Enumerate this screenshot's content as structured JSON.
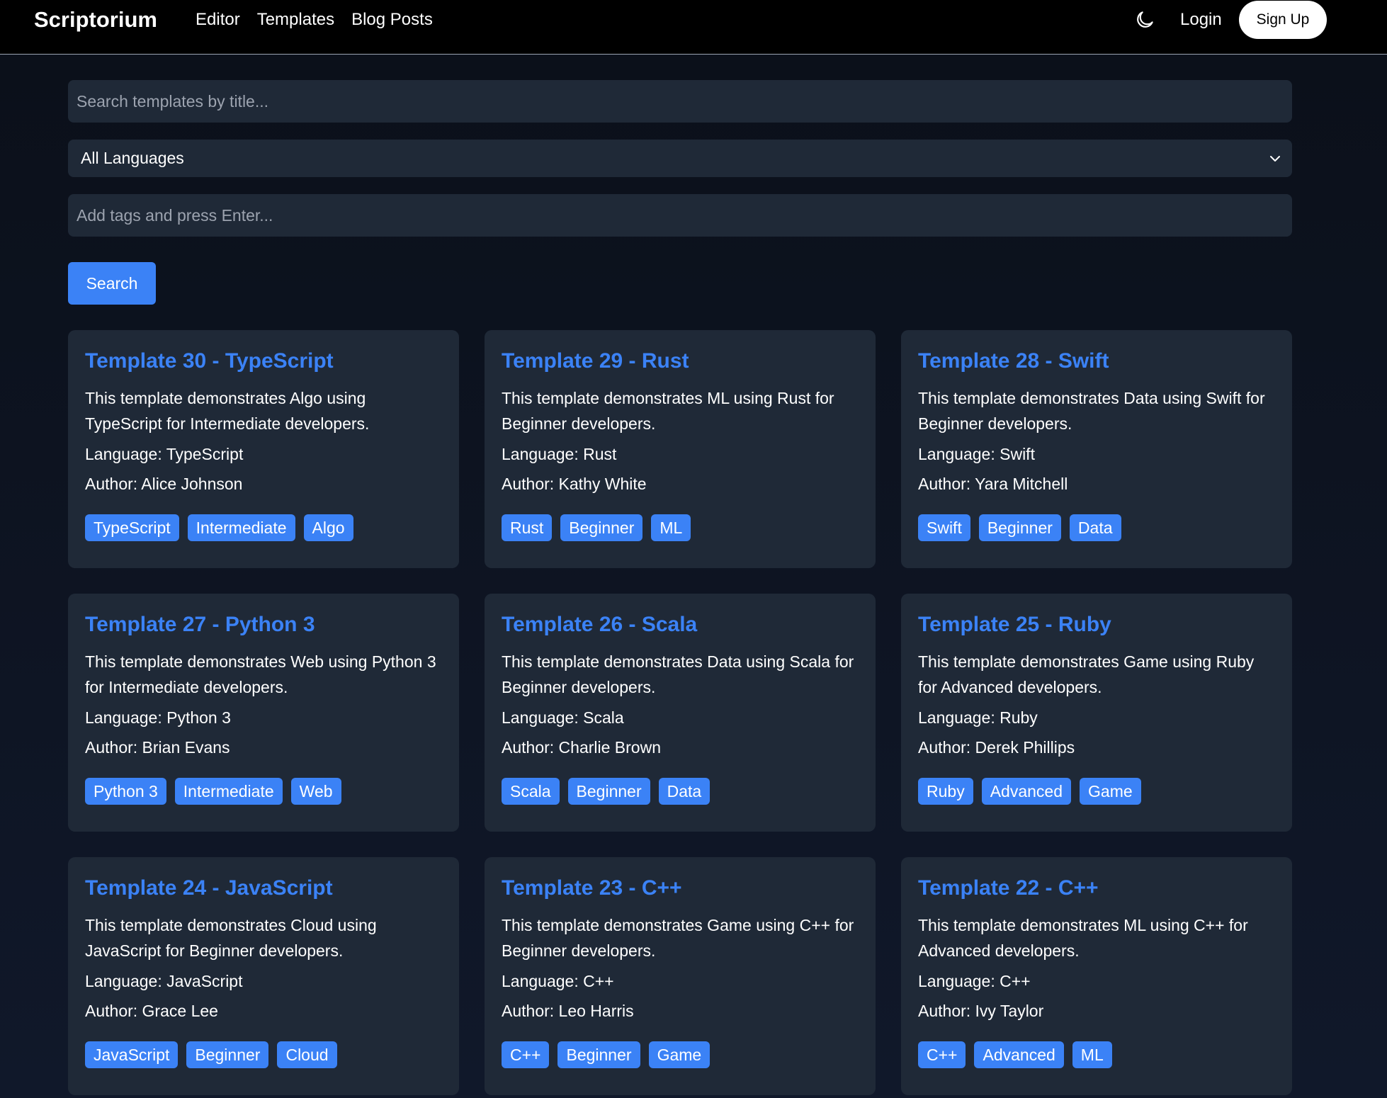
{
  "header": {
    "brand": "Scriptorium",
    "nav": [
      "Editor",
      "Templates",
      "Blog Posts"
    ],
    "theme_icon": "moon-icon",
    "login": "Login",
    "signup": "Sign Up"
  },
  "filters": {
    "search_placeholder": "Search templates by title...",
    "language_selected": "All Languages",
    "tags_placeholder": "Add tags and press Enter...",
    "search_button": "Search"
  },
  "colors": {
    "accent": "#3b82f6",
    "card_bg": "#1f2937",
    "page_bg": "#0d1320"
  },
  "templates": [
    {
      "title": "Template 30 - TypeScript",
      "description": "This template demonstrates Algo using TypeScript for Intermediate developers.",
      "language": "Language: TypeScript",
      "author": "Author: Alice Johnson",
      "tags": [
        "TypeScript",
        "Intermediate",
        "Algo"
      ]
    },
    {
      "title": "Template 29 - Rust",
      "description": "This template demonstrates ML using Rust for Beginner developers.",
      "language": "Language: Rust",
      "author": "Author: Kathy White",
      "tags": [
        "Rust",
        "Beginner",
        "ML"
      ]
    },
    {
      "title": "Template 28 - Swift",
      "description": "This template demonstrates Data using Swift for Beginner developers.",
      "language": "Language: Swift",
      "author": "Author: Yara Mitchell",
      "tags": [
        "Swift",
        "Beginner",
        "Data"
      ]
    },
    {
      "title": "Template 27 - Python 3",
      "description": "This template demonstrates Web using Python 3 for Intermediate developers.",
      "language": "Language: Python 3",
      "author": "Author: Brian Evans",
      "tags": [
        "Python 3",
        "Intermediate",
        "Web"
      ]
    },
    {
      "title": "Template 26 - Scala",
      "description": "This template demonstrates Data using Scala for Beginner developers.",
      "language": "Language: Scala",
      "author": "Author: Charlie Brown",
      "tags": [
        "Scala",
        "Beginner",
        "Data"
      ]
    },
    {
      "title": "Template 25 - Ruby",
      "description": "This template demonstrates Game using Ruby for Advanced developers.",
      "language": "Language: Ruby",
      "author": "Author: Derek Phillips",
      "tags": [
        "Ruby",
        "Advanced",
        "Game"
      ]
    },
    {
      "title": "Template 24 - JavaScript",
      "description": "This template demonstrates Cloud using JavaScript for Beginner developers.",
      "language": "Language: JavaScript",
      "author": "Author: Grace Lee",
      "tags": [
        "JavaScript",
        "Beginner",
        "Cloud"
      ]
    },
    {
      "title": "Template 23 - C++",
      "description": "This template demonstrates Game using C++ for Beginner developers.",
      "language": "Language: C++",
      "author": "Author: Leo Harris",
      "tags": [
        "C++",
        "Beginner",
        "Game"
      ]
    },
    {
      "title": "Template 22 - C++",
      "description": "This template demonstrates ML using C++ for Advanced developers.",
      "language": "Language: C++",
      "author": "Author: Ivy Taylor",
      "tags": [
        "C++",
        "Advanced",
        "ML"
      ]
    }
  ]
}
